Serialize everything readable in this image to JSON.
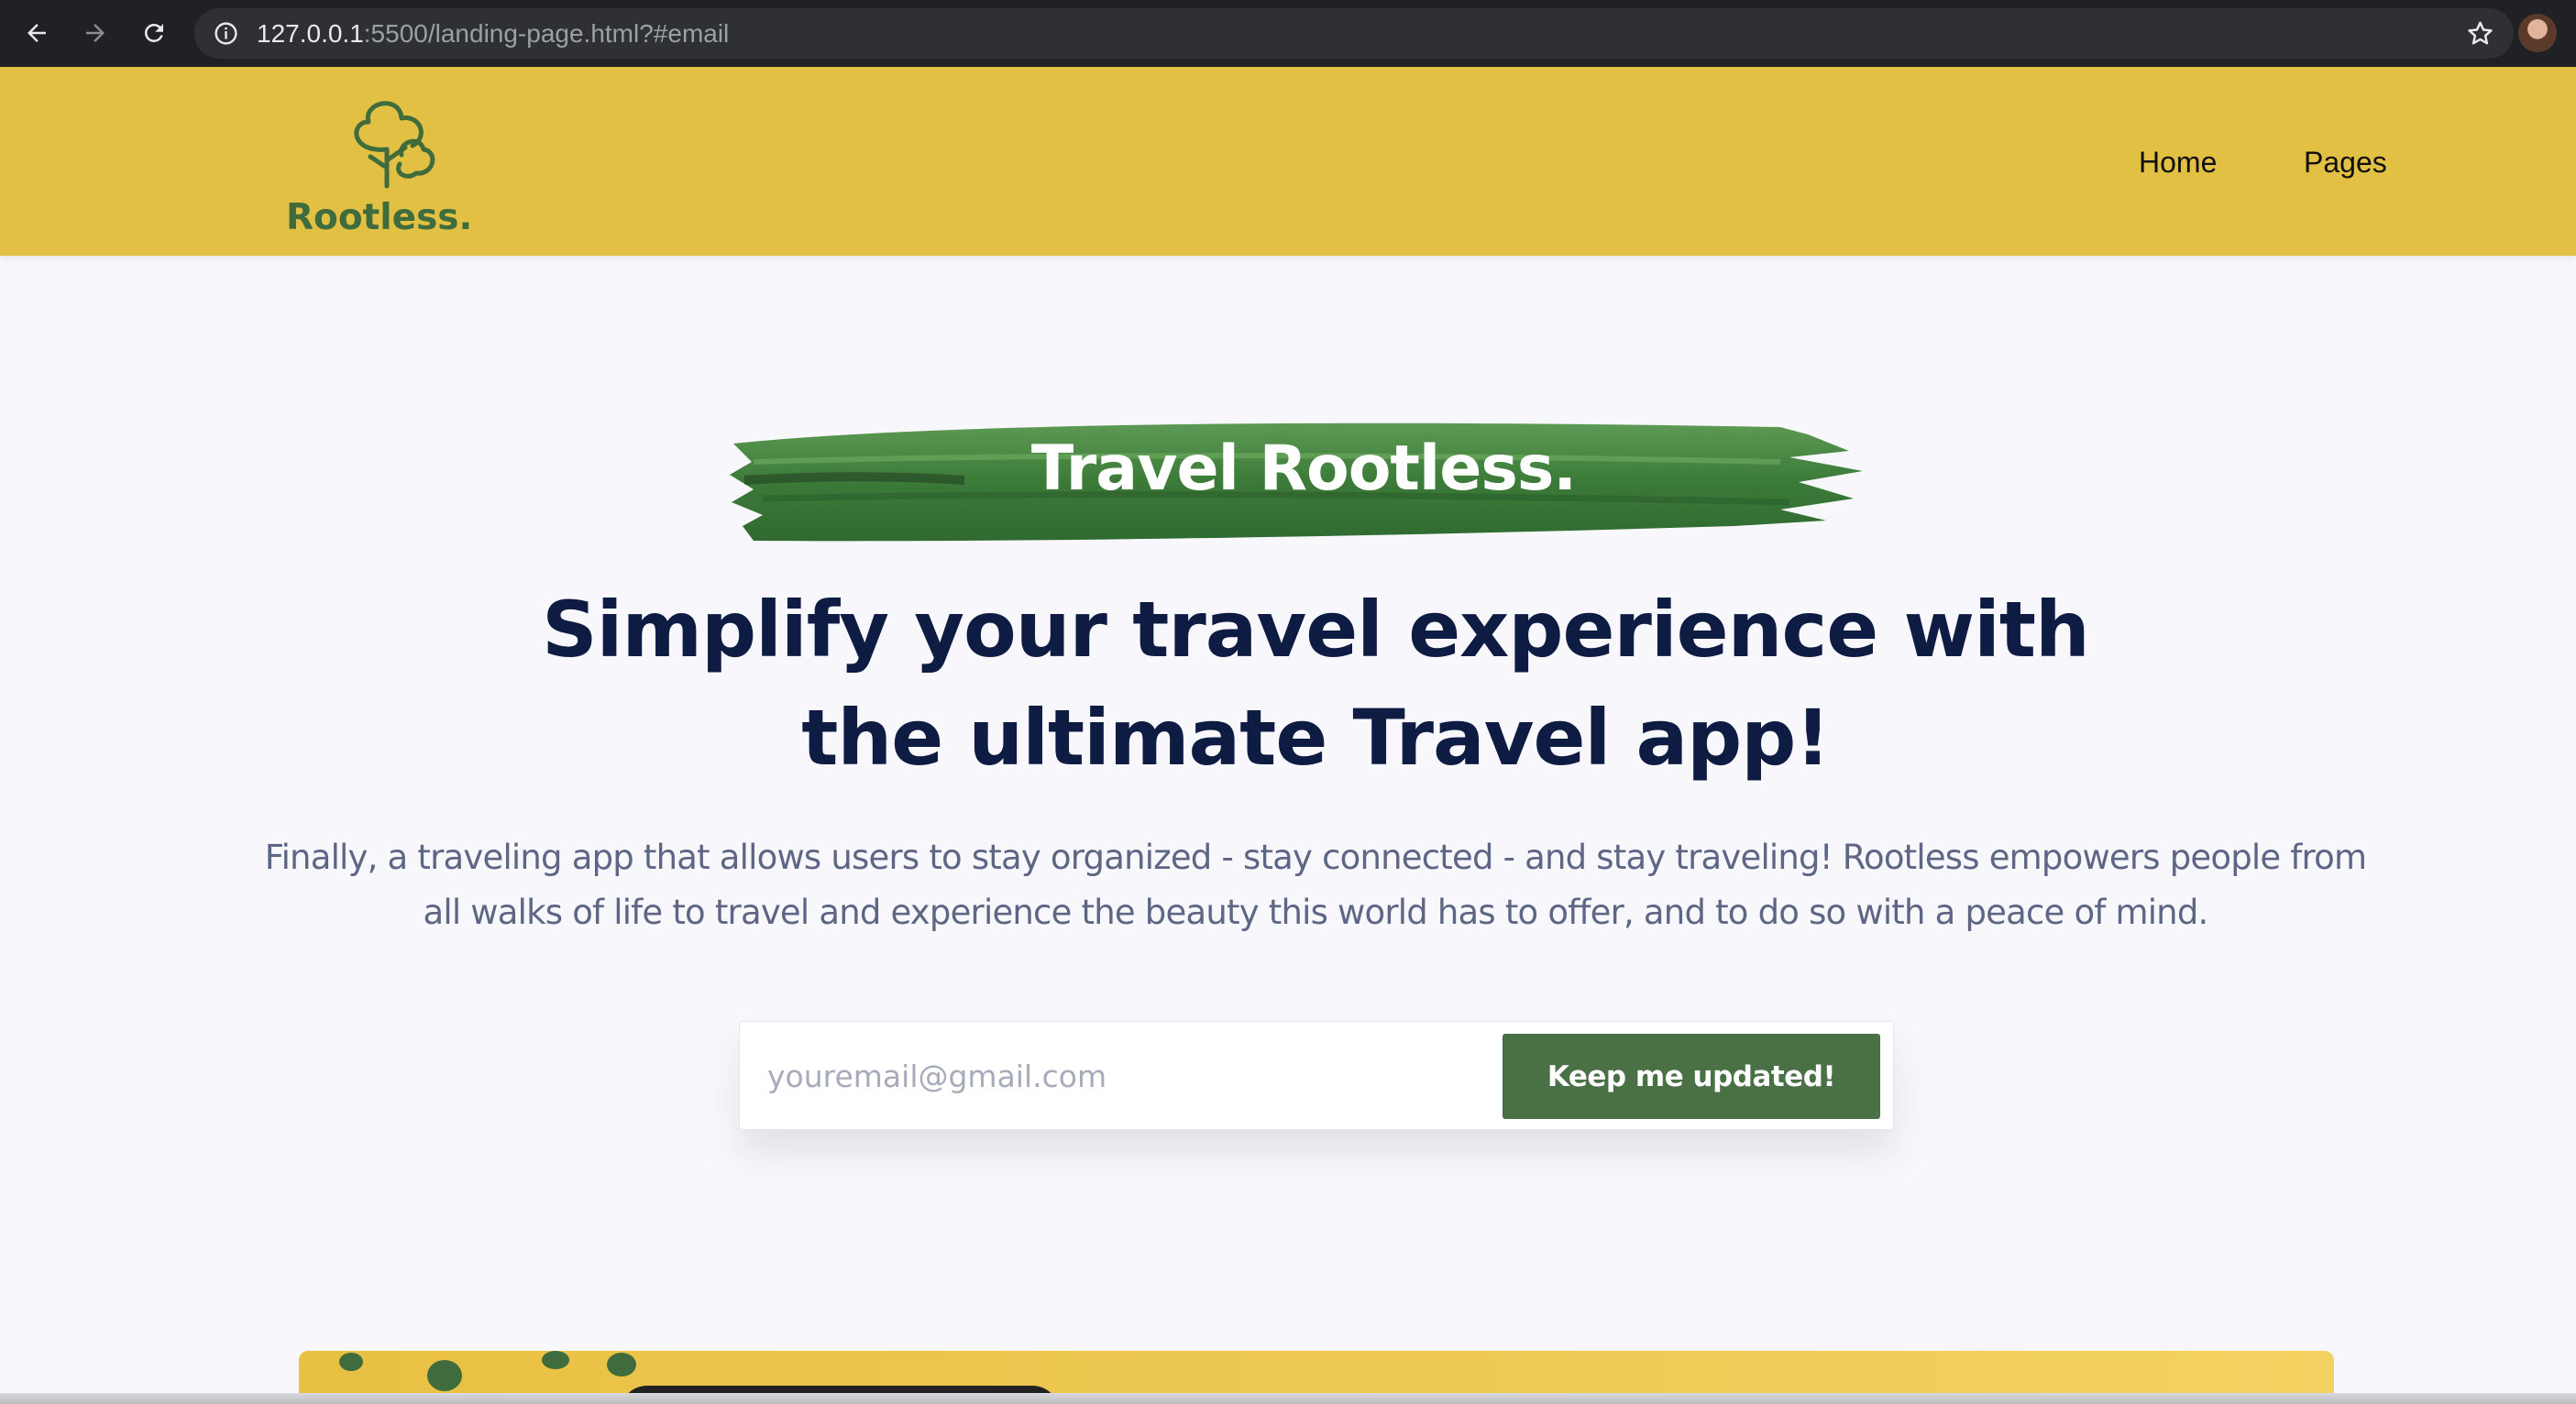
{
  "browser": {
    "url_host": "127.0.0.1",
    "url_rest": ":5500/landing-page.html?#email"
  },
  "header": {
    "logo_text": "Rootless.",
    "nav": [
      {
        "label": "Home"
      },
      {
        "label": "Pages"
      }
    ]
  },
  "hero": {
    "brush_title": "Travel Rootless.",
    "headline": {
      "part1": "Simplify your ",
      "bold1": "travel experience",
      "part2": " with",
      "part3": "the ultimate ",
      "bold2": "Travel",
      "part4": " app!"
    },
    "lead_line1": "Finally, a traveling app that allows users to stay organized - stay connected - and stay traveling! Rootless empowers people from",
    "lead_line2": "all walks of life to travel and experience the beauty this world has to offer, and to do so with a peace of mind.",
    "email_placeholder": "youremail@gmail.com",
    "cta_label": "Keep me updated!"
  },
  "colors": {
    "header_bg": "#e2c043",
    "brand_green": "#4a7046",
    "headline_navy": "#0e1b43"
  }
}
